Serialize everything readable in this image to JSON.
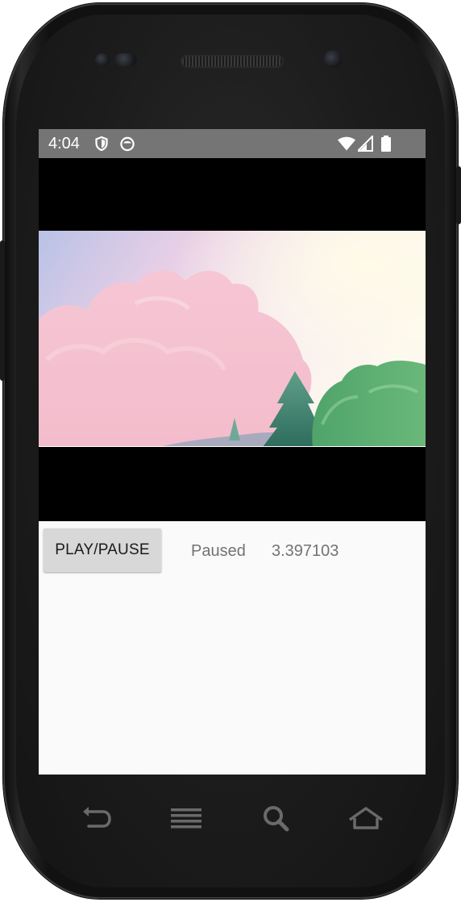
{
  "status_bar": {
    "time": "4:04",
    "left_icons": [
      "shield-icon",
      "app-notification-icon"
    ],
    "right_icons": [
      "wifi-icon",
      "signal-icon",
      "battery-icon"
    ]
  },
  "video": {
    "description_icon": "video-frame"
  },
  "controls": {
    "play_pause_label": "PLAY/PAUSE",
    "state": "Paused",
    "position": "3.397103"
  },
  "nav_bar": {
    "keys": [
      "back-icon",
      "menu-icon",
      "search-icon",
      "home-icon"
    ]
  },
  "colors": {
    "status_bar_bg": "#757575",
    "screen_bg": "#fafafa",
    "button_bg": "#d8d8d8",
    "secondary_text": "#737373"
  }
}
